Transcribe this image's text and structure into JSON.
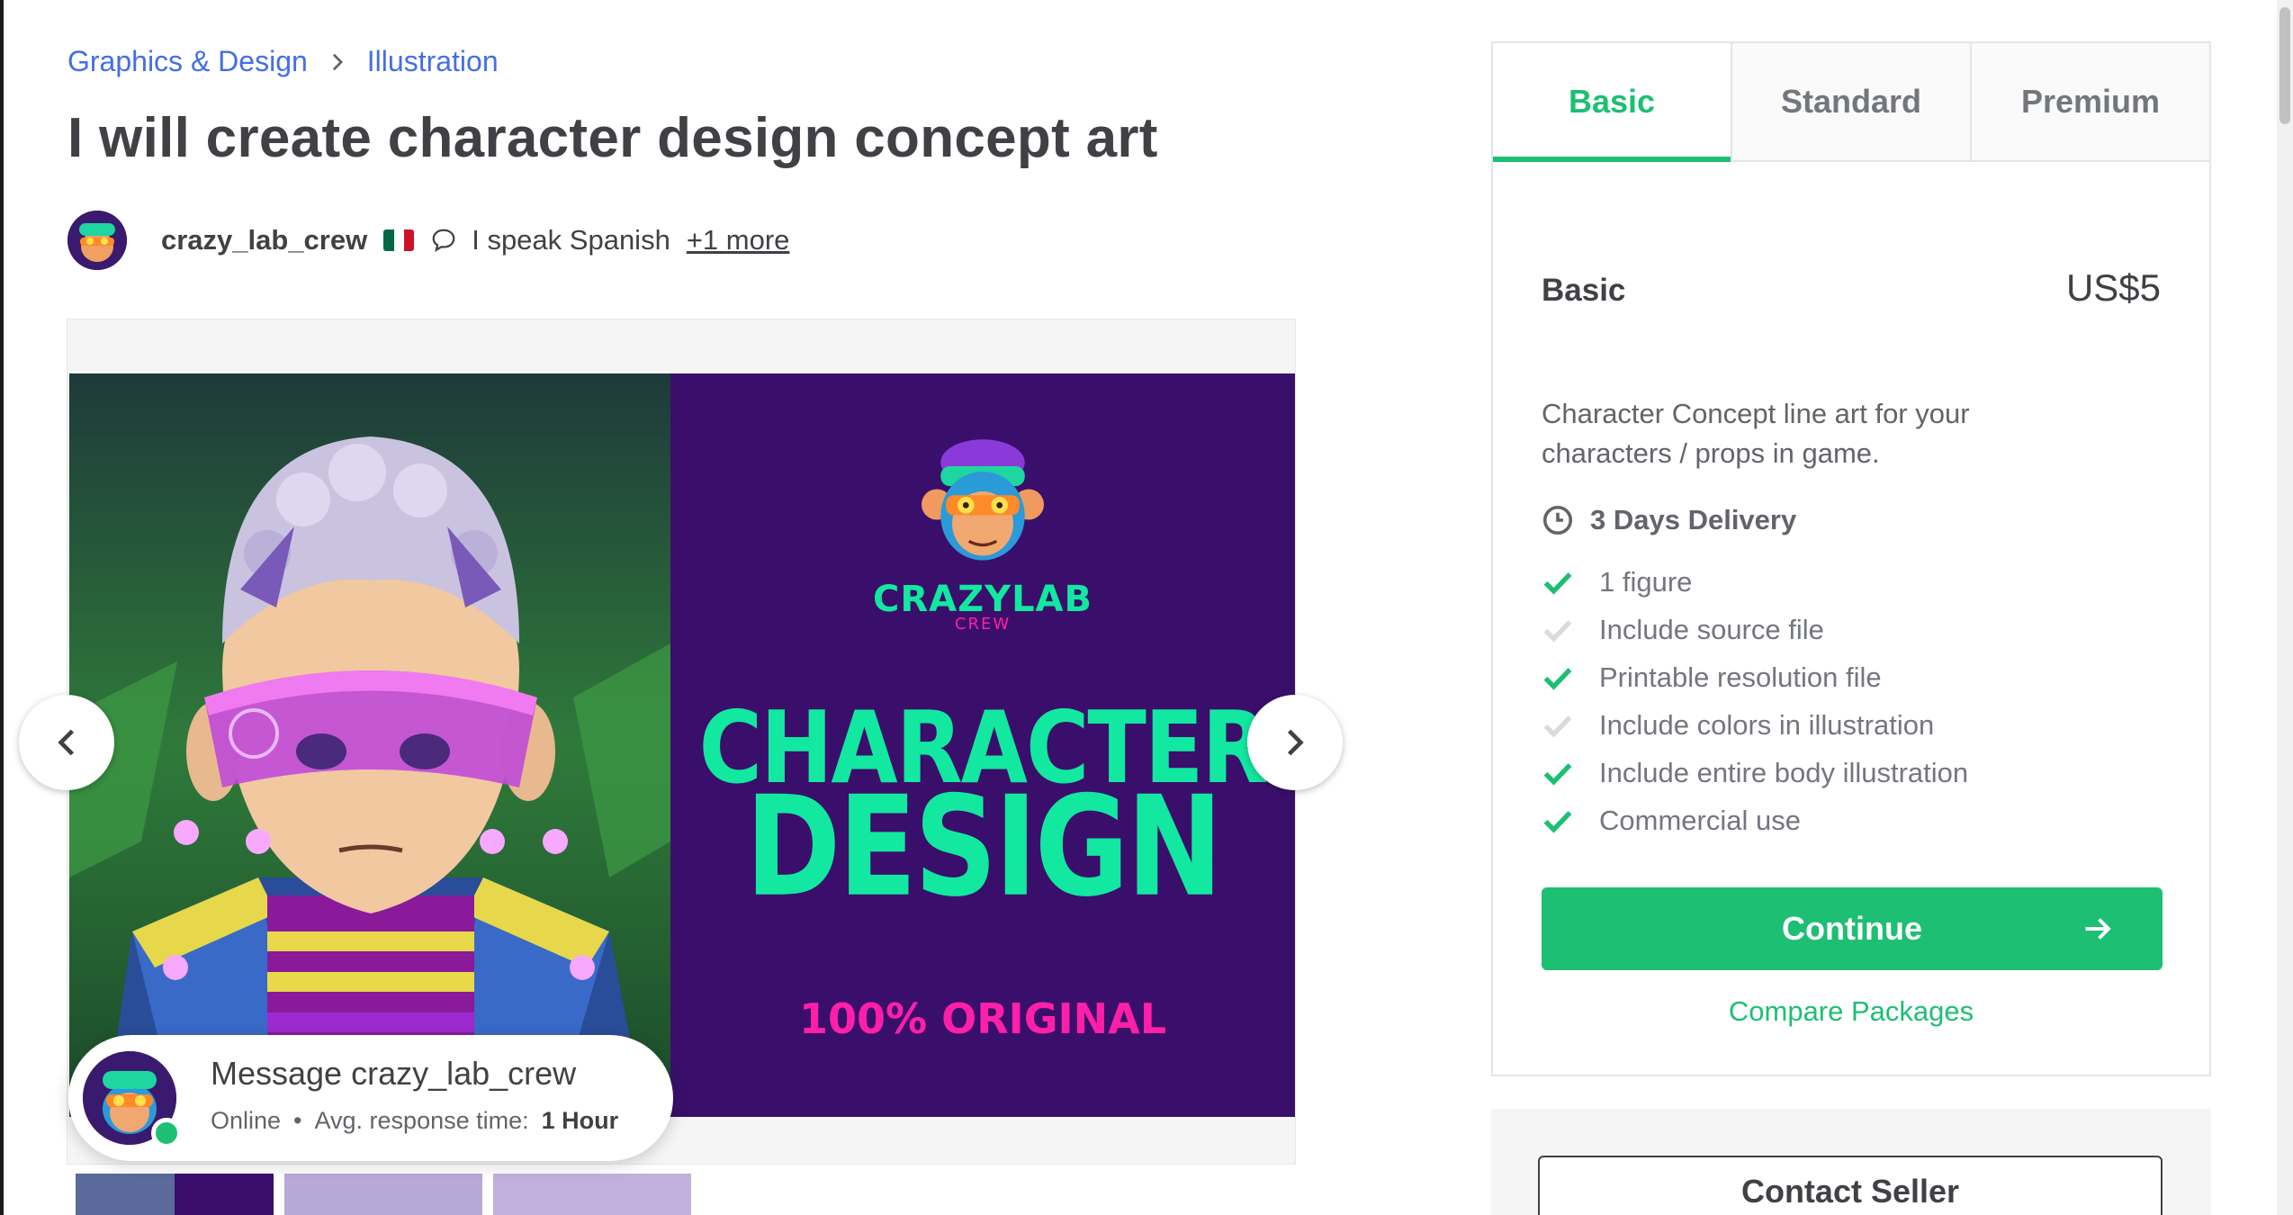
{
  "breadcrumb": {
    "category": "Graphics & Design",
    "subcategory": "Illustration"
  },
  "gig": {
    "title": "I will create character design concept art"
  },
  "seller": {
    "username": "crazy_lab_crew",
    "country_flag": "mexico-flag-icon",
    "language_text": "I speak Spanish",
    "more_languages": "+1 more"
  },
  "gallery": {
    "slide_logo_text": "CRAZYLAB",
    "slide_logo_sub": "CREW",
    "slide_heading_1": "CHARACTER",
    "slide_heading_2": "DESIGN",
    "slide_tagline": "100% ORIGINAL",
    "prev_icon": "chevron-left-icon",
    "next_icon": "chevron-right-icon"
  },
  "message": {
    "title": "Message crazy_lab_crew",
    "status": "Online",
    "separator": "•",
    "response_label": "Avg. response time:",
    "response_value": "1 Hour"
  },
  "package": {
    "tabs": [
      {
        "label": "Basic",
        "active": true
      },
      {
        "label": "Standard",
        "active": false
      },
      {
        "label": "Premium",
        "active": false
      }
    ],
    "name": "Basic",
    "price": "US$5",
    "description": "Character Concept line art for your characters / props in game.",
    "delivery": "3 Days Delivery",
    "features": [
      {
        "label": "1 figure",
        "included": true
      },
      {
        "label": "Include source file",
        "included": false
      },
      {
        "label": "Printable resolution file",
        "included": true
      },
      {
        "label": "Include colors in illustration",
        "included": false
      },
      {
        "label": "Include entire body illustration",
        "included": true
      },
      {
        "label": "Commercial use",
        "included": true
      }
    ],
    "continue_label": "Continue",
    "compare_label": "Compare Packages",
    "contact_label": "Contact Seller"
  },
  "colors": {
    "accent_green": "#1dbf73",
    "link_blue": "#446ee7",
    "text_dark": "#404145",
    "slide_purple": "#3a0f6b",
    "slide_mint": "#12e8a0",
    "slide_pink": "#ff1fa8"
  }
}
